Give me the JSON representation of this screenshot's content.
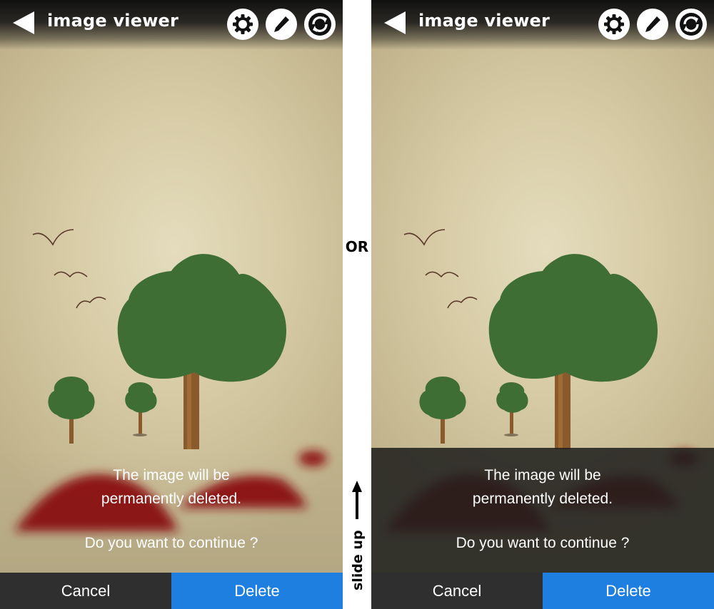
{
  "separator": {
    "or_label": "OR",
    "slide_up_label": "slide up"
  },
  "panels": [
    {
      "header": {
        "title": "image viewer"
      },
      "dialog": {
        "message_line1": "The image will be",
        "message_line2": "permanently deleted.",
        "question": "Do you want to continue ?"
      },
      "buttons": {
        "cancel": "Cancel",
        "delete": "Delete"
      }
    },
    {
      "header": {
        "title": "image viewer"
      },
      "dialog": {
        "message_line1": "The image will be",
        "message_line2": "permanently deleted.",
        "question": "Do you want to continue ?"
      },
      "buttons": {
        "cancel": "Cancel",
        "delete": "Delete"
      }
    }
  ],
  "colors": {
    "delete_button": "#1e7fe0",
    "cancel_button": "#2f2f2f",
    "tree_foliage": "#3f6e35",
    "hills": "#8f1414"
  },
  "icons": [
    "back-arrow-icon",
    "gear-icon",
    "pencil-icon",
    "refresh-icon"
  ]
}
